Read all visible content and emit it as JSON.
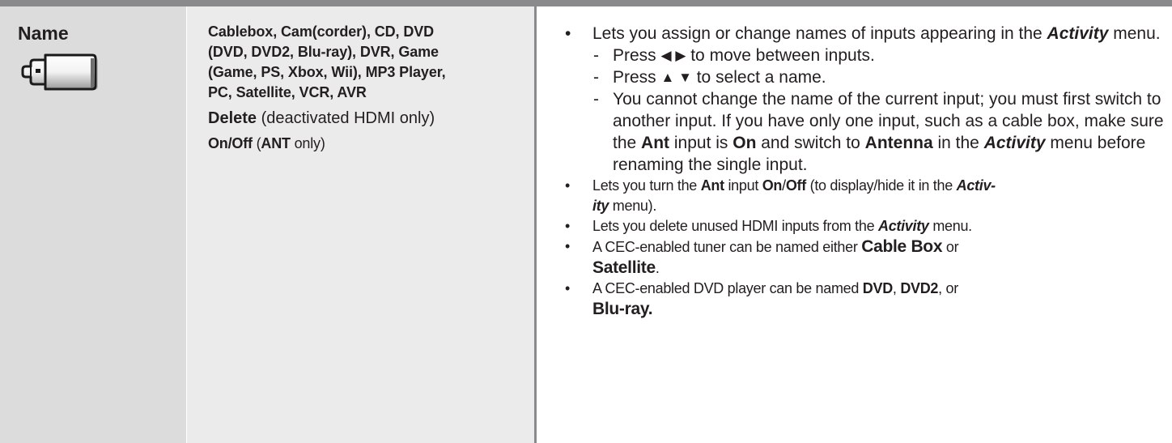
{
  "name_column": {
    "title": "Name",
    "icon": "input-plug-icon"
  },
  "options_column": {
    "names_lines": [
      "Cablebox, Cam(corder), CD, DVD",
      "(DVD, DVD2, Blu-ray), DVR, Game",
      "(Game, PS, Xbox, Wii), MP3 Player,",
      "PC,  Satellite, VCR, AVR"
    ],
    "delete_label": "Delete",
    "delete_note": " (deactivated HDMI only)",
    "onoff_label": "On/Off",
    "onoff_paren_open": " (",
    "onoff_ant": "ANT",
    "onoff_note": " only)"
  },
  "description": {
    "b1_text": "Lets you assign or change names of inputs appearing in the ",
    "b1_activity": "Activity",
    "b1_end": " menu.",
    "sub1_pre": "Press ",
    "sub1_arrows": "◀ ▶",
    "sub1_post": " to move between inputs.",
    "sub2_pre": "Press ",
    "sub2_arrows": "▲ ▼",
    "sub2_post": " to select a name.",
    "sub3_a": "You cannot change the name of the current input; you must first switch to another input.  If you have only one input, such as a cable box, make sure the ",
    "sub3_ant": "Ant",
    "sub3_b": " input is ",
    "sub3_on": "On",
    "sub3_c": " and switch to ",
    "sub3_antenna": "Antenna",
    "sub3_d": " in the ",
    "sub3_activity": "Activity",
    "sub3_e": " menu before renaming the single input.",
    "b2_a": "Lets you turn the ",
    "b2_ant": "Ant",
    "b2_b": " input ",
    "b2_on": "On",
    "b2_slash": "/",
    "b2_off": "Off",
    "b2_c": " (to display/hide it in the ",
    "b2_activ": "Activ-",
    "b2_ity": "ity",
    "b2_d": " menu).",
    "b3_a": "Lets you delete unused HDMI inputs from the ",
    "b3_activity": "Activity",
    "b3_b": " menu.",
    "b4_a": "A CEC-enabled tuner can be named either ",
    "b4_cablebox": "Cable Box",
    "b4_or": " or",
    "b4_satellite": "Satellite",
    "b4_end": ".",
    "b5_a": "A CEC-enabled DVD player can be named ",
    "b5_dvd": "DVD",
    "b5_comma": ", ",
    "b5_dvd2": "DVD2",
    "b5_or": ", or",
    "b5_bluray": "Blu-ray.",
    "bullet_glyph": "•",
    "dash_glyph": "-"
  },
  "colors": {
    "rule": "#8a8a8c",
    "name_bg": "#dcdcdd",
    "options_bg": "#ebebeb",
    "text": "#231f20"
  }
}
